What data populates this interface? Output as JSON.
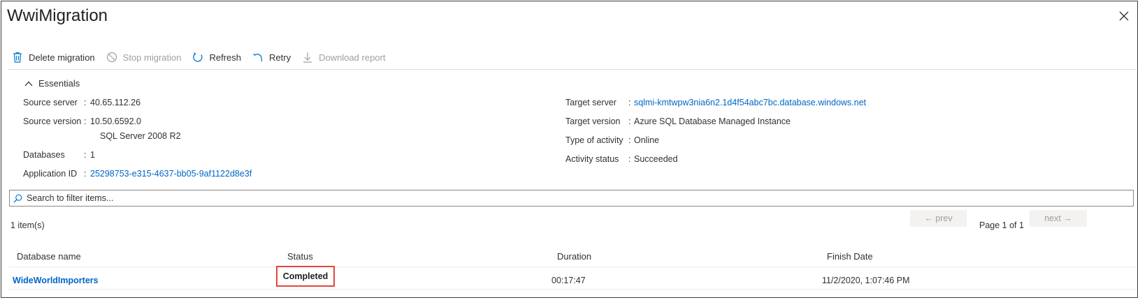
{
  "window": {
    "title": "WwiMigration"
  },
  "toolbar": {
    "items": [
      {
        "label": "Delete migration",
        "icon": "trash-icon",
        "enabled": true
      },
      {
        "label": "Stop migration",
        "icon": "stop-icon",
        "enabled": false
      },
      {
        "label": "Refresh",
        "icon": "refresh-icon",
        "enabled": true
      },
      {
        "label": "Retry",
        "icon": "retry-icon",
        "enabled": true
      },
      {
        "label": "Download report",
        "icon": "download-icon",
        "enabled": false
      }
    ]
  },
  "essentials": {
    "label": "Essentials",
    "left": [
      {
        "label": "Source server",
        "value": "40.65.112.26"
      },
      {
        "label": "Source version",
        "value": "10.50.6592.0",
        "value2": "SQL Server 2008 R2"
      },
      {
        "label": "Databases",
        "value": "1"
      },
      {
        "label": "Application ID",
        "value": "25298753-e315-4637-bb05-9af1122d8e3f",
        "link": true
      }
    ],
    "right": [
      {
        "label": "Target server",
        "value": "sqlmi-kmtwpw3nia6n2.1d4f54abc7bc.database.windows.net",
        "link": true
      },
      {
        "label": "Target version",
        "value": "Azure SQL Database Managed Instance"
      },
      {
        "label": "Type of activity",
        "value": "Online"
      },
      {
        "label": "Activity status",
        "value": "Succeeded"
      }
    ]
  },
  "search": {
    "placeholder": "Search to filter items...",
    "value": ""
  },
  "list": {
    "count_text": "1 item(s)",
    "prev_label": "← prev",
    "next_label": "next →",
    "page_text": "Page 1 of 1",
    "columns": [
      "Database name",
      "Status",
      "Duration",
      "Finish Date"
    ],
    "rows": [
      {
        "name": "WideWorldImporters",
        "status": "Completed",
        "duration": "00:17:47",
        "finish": "11/2/2020, 1:07:46 PM"
      }
    ]
  },
  "colors": {
    "link": "#0066c8",
    "highlight": "#e0473e",
    "accent": "#0078d4"
  }
}
